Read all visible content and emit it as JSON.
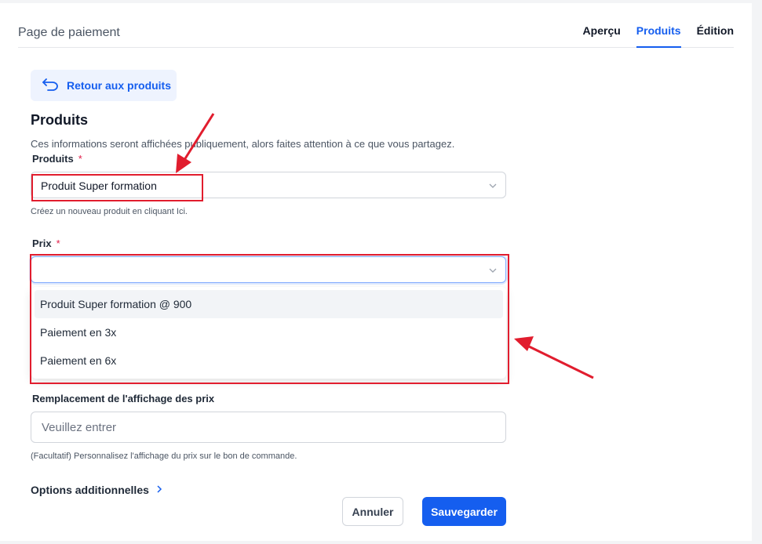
{
  "header": {
    "title": "Page de paiement",
    "tabs": [
      {
        "label": "Aperçu",
        "active": false
      },
      {
        "label": "Produits",
        "active": true
      },
      {
        "label": "Édition",
        "active": false
      }
    ]
  },
  "back_button": {
    "label": "Retour aux produits",
    "icon": "undo-arrow-icon"
  },
  "section": {
    "title": "Produits",
    "description": "Ces informations seront affichées publiquement, alors faites attention à ce que vous partagez."
  },
  "product_field": {
    "label": "Produits",
    "required_mark": "*",
    "value": "Produit Super formation",
    "hint": "Créez un nouveau produit en cliquant Ici."
  },
  "price_field": {
    "label": "Prix",
    "required_mark": "*",
    "value": "",
    "options": [
      "Produit Super formation @ 900",
      "Paiement en 3x",
      "Paiement en 6x"
    ]
  },
  "price_display_field": {
    "label": "Remplacement de l'affichage des prix",
    "placeholder": "Veuillez entrer",
    "hint": "(Facultatif) Personnalisez l'affichage du prix sur le bon de commande."
  },
  "additional_options": {
    "label": "Options additionnelles",
    "icon": "chevron-right-icon"
  },
  "footer": {
    "cancel_label": "Annuler",
    "save_label": "Sauvegarder"
  },
  "colors": {
    "accent": "#155eef",
    "annotation": "#e11d2e"
  }
}
